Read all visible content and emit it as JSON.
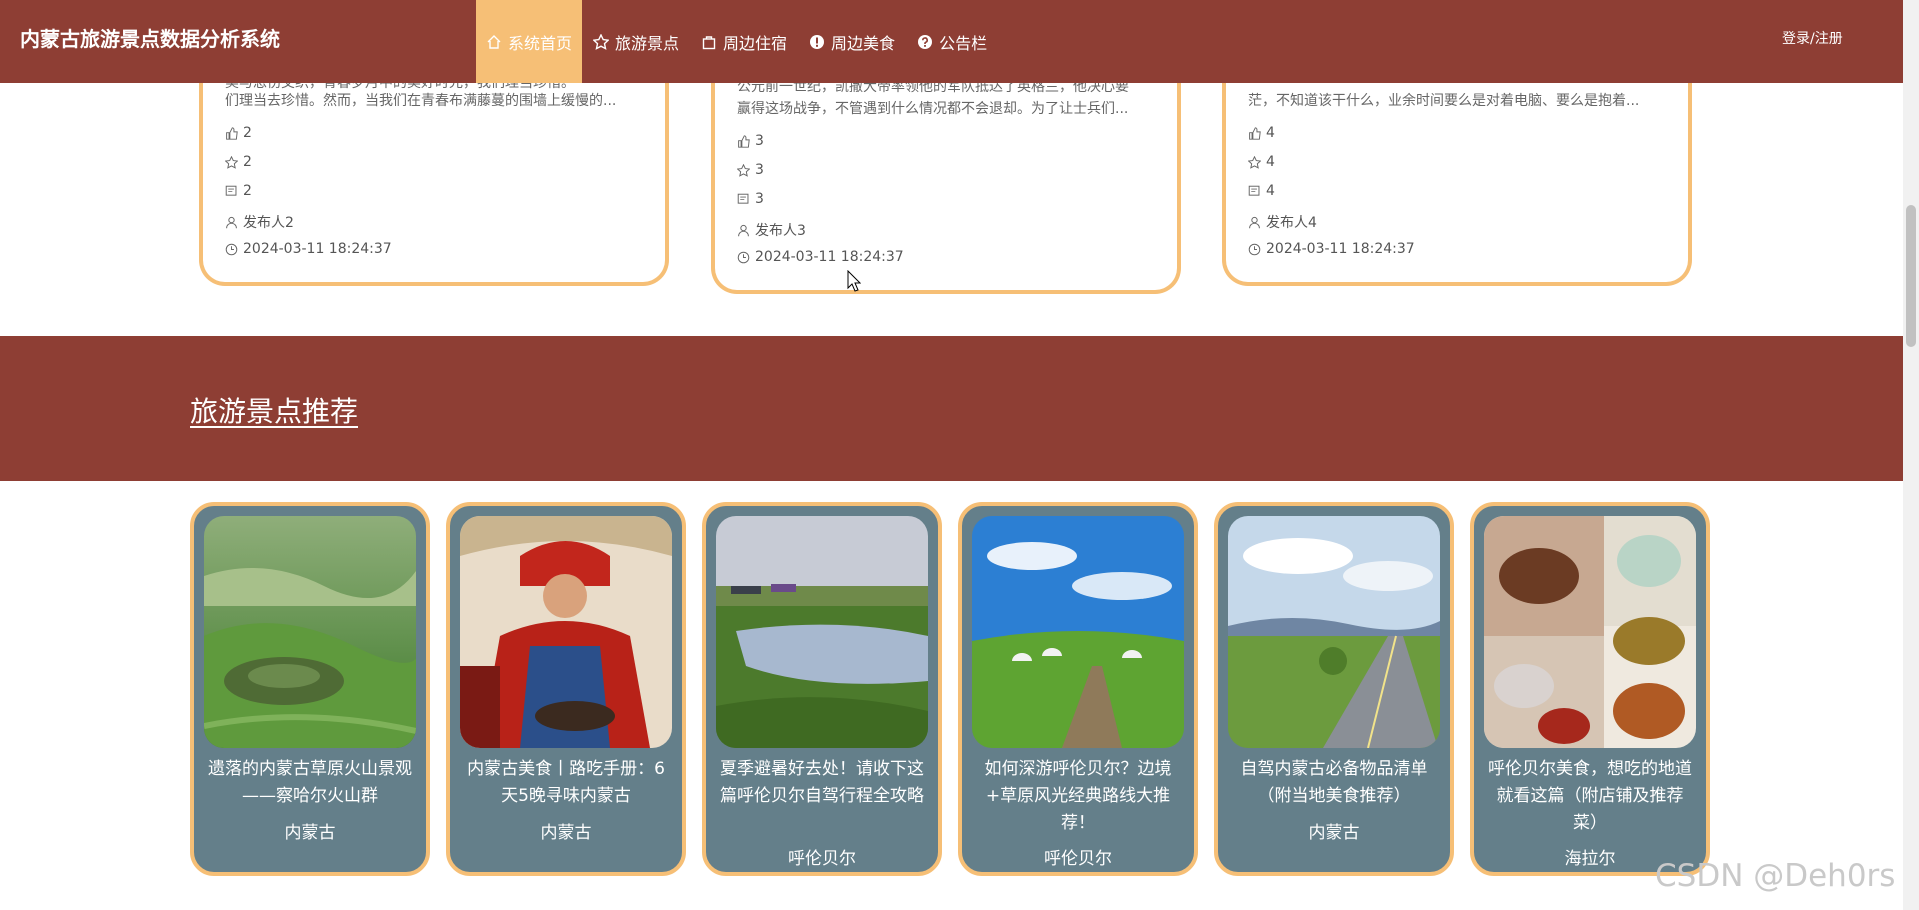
{
  "app": {
    "title": "内蒙古旅游景点数据分析系统"
  },
  "nav": {
    "items": [
      {
        "label": "系统首页",
        "icon": "home-icon",
        "active": true
      },
      {
        "label": "旅游景点",
        "icon": "star-icon",
        "active": false
      },
      {
        "label": "周边住宿",
        "icon": "bag-icon",
        "active": false
      },
      {
        "label": "周边美食",
        "icon": "info-icon",
        "active": false
      },
      {
        "label": "公告栏",
        "icon": "help-icon",
        "active": false
      }
    ],
    "login": "登录/注册"
  },
  "news": [
    {
      "line1": "美与悲伤交织，青春岁月中的美好时光，我们理当珍惜。",
      "line2": "们理当去珍惜。然而，当我们在青春布满藤蔓的围墙上缓慢的...",
      "likes": "2",
      "favorites": "2",
      "comments": "2",
      "author": "发布人2",
      "time": "2024-03-11 18:24:37"
    },
    {
      "line1": "公元前一世纪，凯撒大帝率领他的军队抵达了英格兰，他决心要",
      "line2": "赢得这场战争，不管遇到什么情况都不会退却。为了让士兵们...",
      "likes": "3",
      "favorites": "3",
      "comments": "3",
      "author": "发布人3",
      "time": "2024-03-11 18:24:37"
    },
    {
      "line1": "茫，不知道该干什么，业余时间要么是对着电脑、要么是抱着...",
      "line2": "",
      "likes": "4",
      "favorites": "4",
      "comments": "4",
      "author": "发布人4",
      "time": "2024-03-11 18:24:37"
    }
  ],
  "section": {
    "title": "旅游景点推荐"
  },
  "spots": [
    {
      "title": "遗落的内蒙古草原火山景观——察哈尔火山群",
      "location": "内蒙古",
      "image": "volcano-grassland"
    },
    {
      "title": "内蒙古美食丨路吃手册：6天5晚寻味内蒙古",
      "location": "内蒙古",
      "image": "mongolian-costume-cooking"
    },
    {
      "title": "夏季避暑好去处！请收下这篇呼伦贝尔自驾行程全攻略",
      "location": "呼伦贝尔",
      "image": "lake-grassland"
    },
    {
      "title": "如何深游呼伦贝尔？边境+草原风光经典路线大推荐！",
      "location": "呼伦贝尔",
      "image": "yurt-grassland"
    },
    {
      "title": "自驾内蒙古必备物品清单（附当地美食推荐）",
      "location": "内蒙古",
      "image": "highway-grassland"
    },
    {
      "title": "呼伦贝尔美食，想吃的地道就看这篇（附店铺及推荐菜）",
      "location": "海拉尔",
      "image": "food-collage"
    }
  ],
  "watermark": "CSDN @Deh0rs",
  "colors": {
    "brand": "#8e3e34",
    "accent": "#f6bf76",
    "card": "#647f8a"
  }
}
